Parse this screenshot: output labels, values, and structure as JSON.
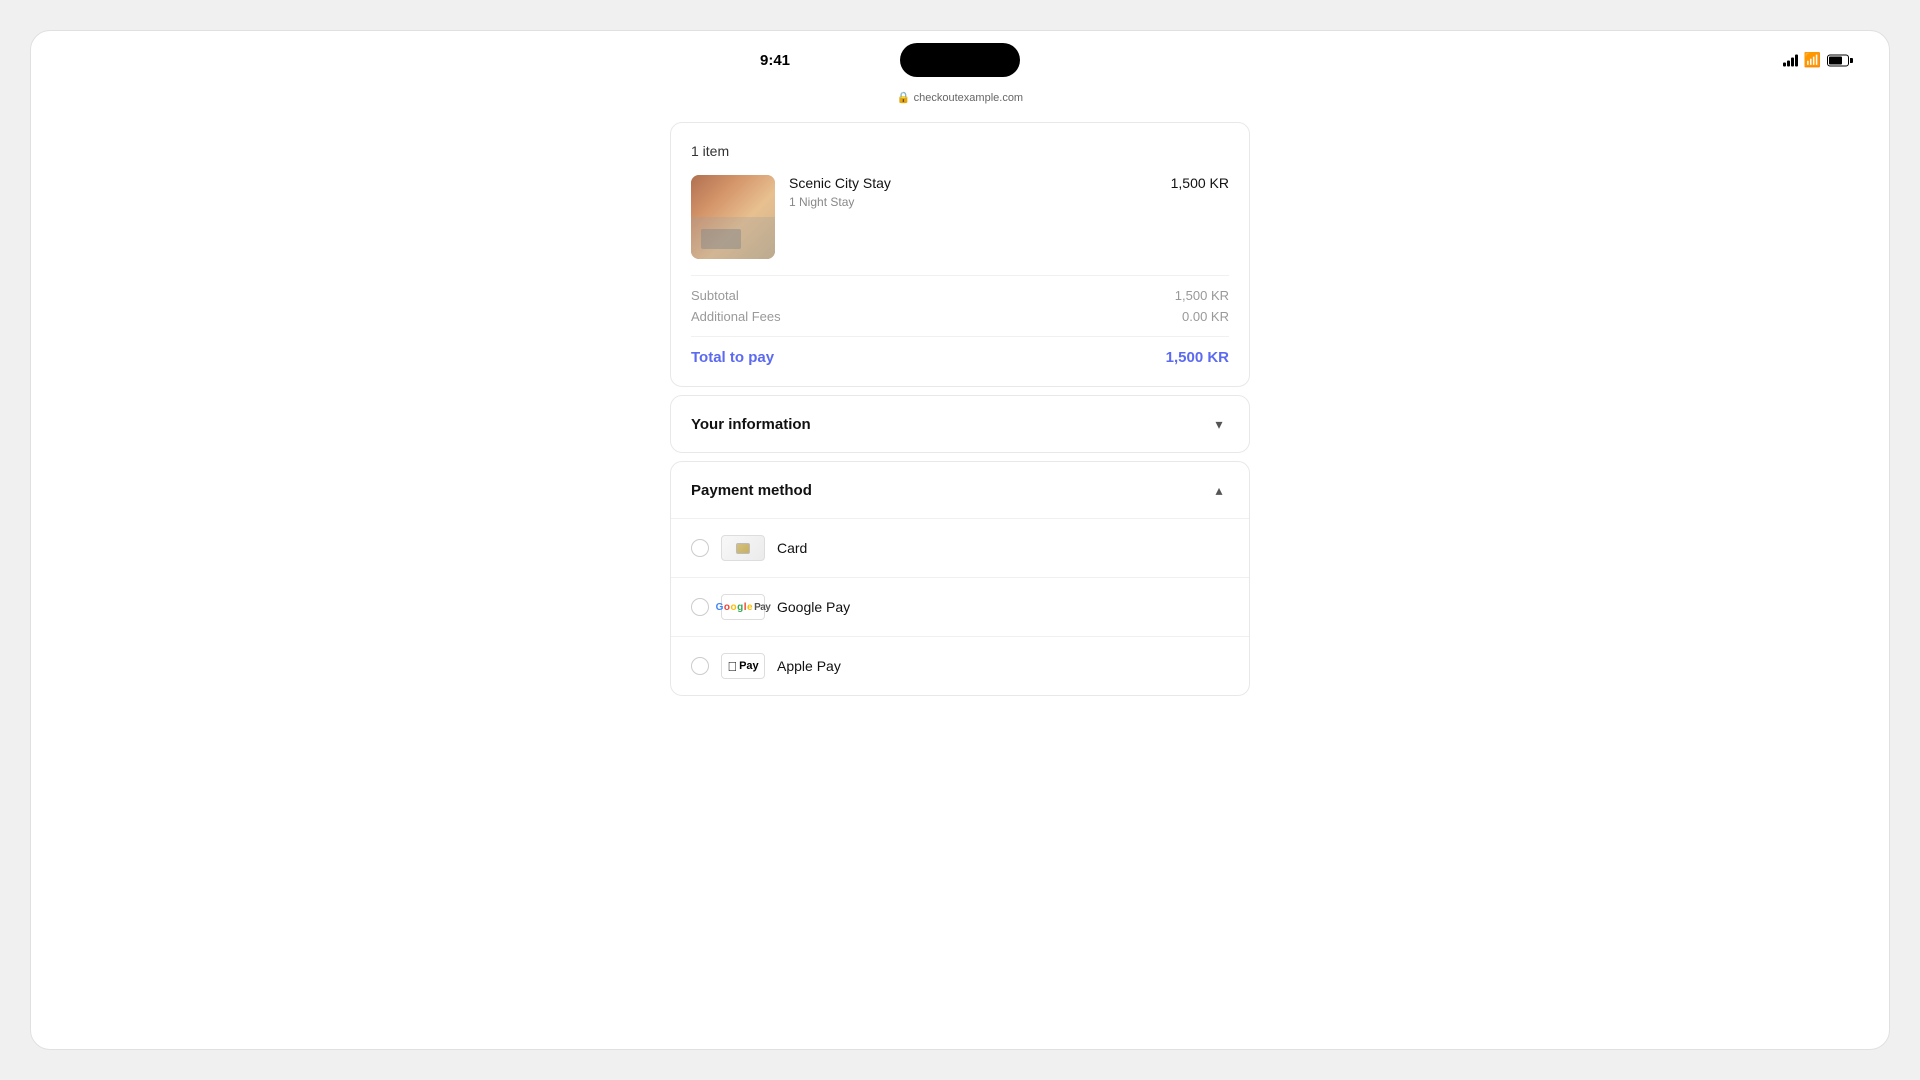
{
  "statusBar": {
    "time": "9:41",
    "url": "checkoutexample.com"
  },
  "orderSummary": {
    "header": "1 item",
    "item": {
      "name": "Scenic City Stay",
      "subtitle": "1 Night Stay",
      "price": "1,500 KR"
    },
    "subtotalLabel": "Subtotal",
    "subtotalValue": "1,500 KR",
    "additionalFeesLabel": "Additional Fees",
    "additionalFeesValue": "0.00 KR",
    "totalLabel": "Total to pay",
    "totalValue": "1,500 KR"
  },
  "yourInformation": {
    "title": "Your information",
    "chevron": "▾"
  },
  "paymentMethod": {
    "title": "Payment method",
    "chevron": "▴",
    "options": [
      {
        "id": "card",
        "label": "Card",
        "type": "card"
      },
      {
        "id": "googlepay",
        "label": "Google Pay",
        "type": "googlepay"
      },
      {
        "id": "applepay",
        "label": "Apple Pay",
        "type": "applepay"
      }
    ]
  }
}
